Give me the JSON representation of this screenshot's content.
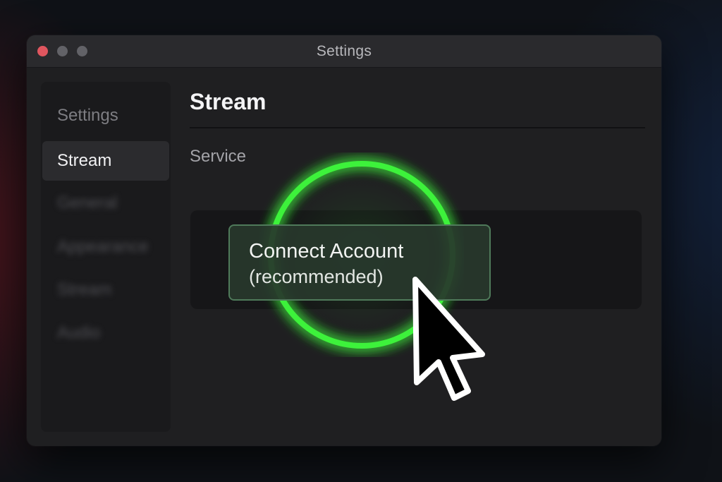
{
  "window": {
    "title": "Settings",
    "controls": [
      "close",
      "minimize",
      "maximize"
    ]
  },
  "sidebar": {
    "heading": "Settings",
    "active_item": "Stream",
    "blurred_items": [
      "General",
      "Appearance",
      "Stream",
      "Audio"
    ]
  },
  "main": {
    "title": "Stream",
    "section_label": "Service",
    "connect_button": {
      "line1": "Connect Account",
      "line2": "(recommended)"
    }
  },
  "highlight": {
    "ring_color": "#3df23a",
    "icon": "highlight-circle-icon"
  },
  "pointer": {
    "icon": "mouse-cursor-icon"
  },
  "colors": {
    "window_bg": "#1f1f21",
    "titlebar_bg": "#2a2a2d",
    "close_dot": "#e0565f",
    "inactive_dot": "#626267",
    "accent_green": "#3df23a"
  }
}
